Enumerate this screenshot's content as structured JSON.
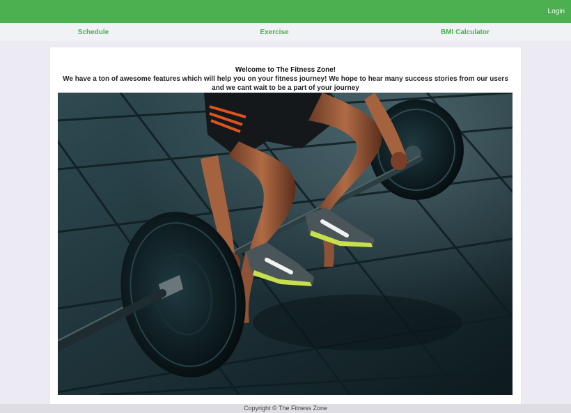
{
  "header": {
    "login_label": "Login",
    "brand_color": "#4caf50"
  },
  "nav": {
    "items": [
      {
        "label": "Schedule"
      },
      {
        "label": "Exercise"
      },
      {
        "label": "BMI Calculator"
      }
    ]
  },
  "main": {
    "title": "Welcome to The Fitness Zone!",
    "description": "We have a ton of awesome features which will help you on your fitness journey! We hope to hear many success stories from our users and we cant wait to be a part of your journey",
    "hero_image": "barbell-deadlift-photo"
  },
  "footer": {
    "copyright": "Copyright © The Fitness Zone"
  }
}
